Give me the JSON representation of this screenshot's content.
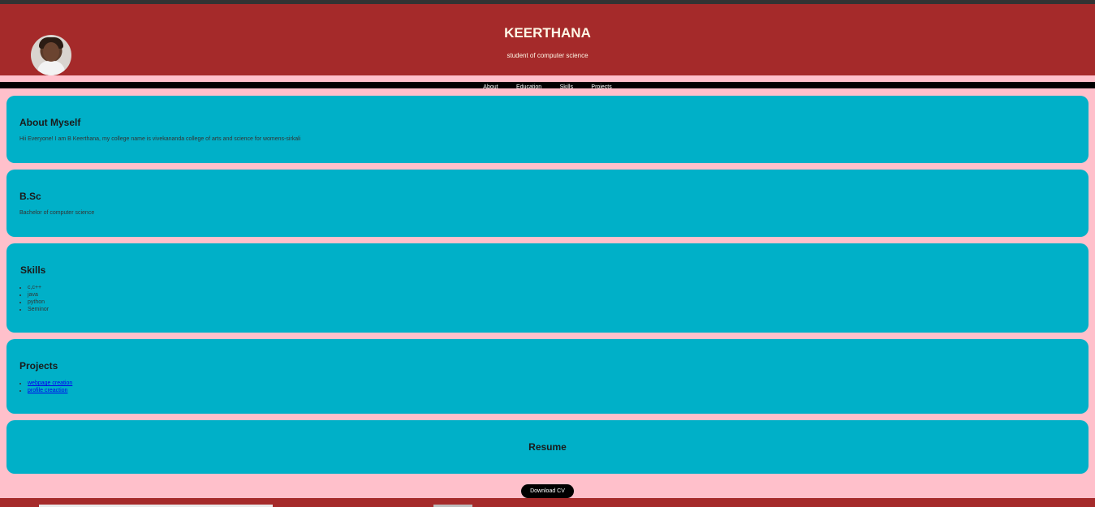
{
  "profile": {
    "name": "KEERTHANA",
    "subtitle": "student of computer science"
  },
  "nav": {
    "items": [
      {
        "label": "About"
      },
      {
        "label": "Education"
      },
      {
        "label": "Skills"
      },
      {
        "label": "Projects"
      }
    ]
  },
  "about": {
    "heading": "About Myself",
    "text": "Hii Everyone! I am B Keerthana, my college name is vivekananda college of arts and science for womens-sirkali"
  },
  "education": {
    "heading": "B.Sc",
    "text": "Bachelor of computer science"
  },
  "skills": {
    "heading": "Skills",
    "items": [
      "c,c++",
      "java",
      "python",
      "Seminor"
    ]
  },
  "projects": {
    "heading": "Projects",
    "items": [
      "webpage creation",
      "profile creaction"
    ]
  },
  "resume": {
    "heading": "Resume",
    "button_label": "Download CV"
  },
  "colors": {
    "page_bg": "#ffc0cb",
    "header_bg": "#a52a2a",
    "card_bg": "#00b0c8",
    "nav_bg": "#000000"
  },
  "icons": {
    "avatar": "profile-photo"
  }
}
